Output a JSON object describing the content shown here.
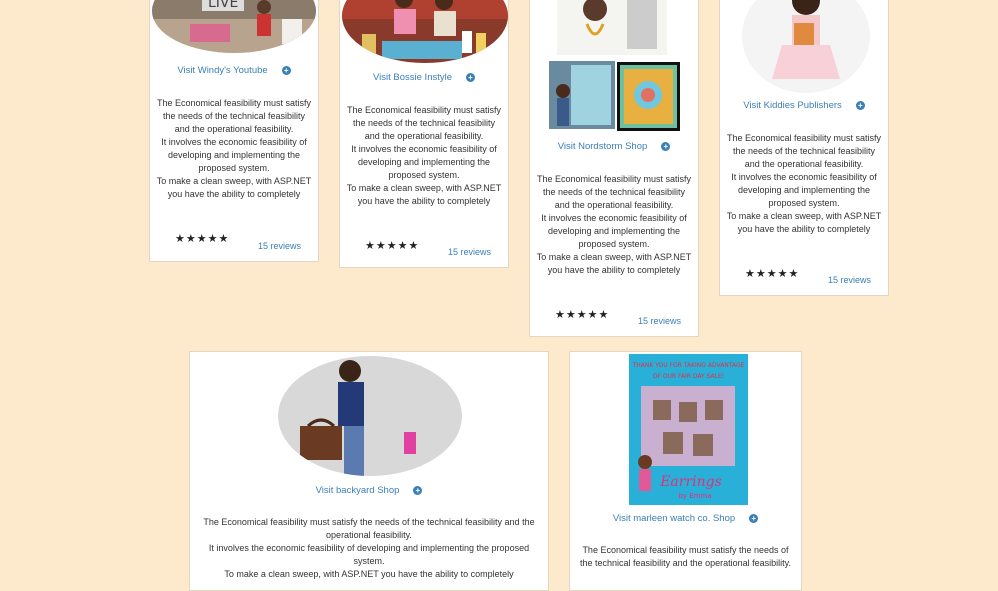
{
  "cards": [
    {
      "link": "Visit Windy's Youtube",
      "desc1": "The Economical feasibility must satisfy the needs of the technical feasibility and the operational feasibility.",
      "desc2": "It involves the economic feasibility of developing and implementing the proposed system.",
      "desc3": "To make a clean sweep, with ASP.NET you have the ability to completely",
      "stars": "★★★★★",
      "reviews": "15 reviews"
    },
    {
      "link": "Visit Bossie Instyle",
      "desc1": "The Economical feasibility must satisfy the needs of the technical feasibility and the operational feasibility.",
      "desc2": "It involves the economic feasibility of developing and implementing the proposed system.",
      "desc3": "To make a clean sweep, with ASP.NET you have the ability to completely",
      "stars": "★★★★★",
      "reviews": "15 reviews"
    },
    {
      "link": "Visit Nordstorm Shop",
      "desc1": "The Economical feasibility must satisfy the needs of the technical feasibility and the operational feasibility.",
      "desc2": "It involves the economic feasibility of developing and implementing the proposed system.",
      "desc3": "To make a clean sweep, with ASP.NET you have the ability to completely",
      "stars": "★★★★★",
      "reviews": "15 reviews"
    },
    {
      "link": "Visit Kiddies Publishers",
      "desc1": "The Economical feasibility must satisfy the needs of the technical feasibility and the operational feasibility.",
      "desc2": "It involves the economic feasibility of developing and implementing the proposed system.",
      "desc3": "To make a clean sweep, with ASP.NET you have the ability to completely",
      "stars": "★★★★★",
      "reviews": "15 reviews"
    },
    {
      "link": "Visit backyard Shop",
      "desc1": "The Economical feasibility must satisfy the needs of the technical feasibility and the operational feasibility.",
      "desc2": "It involves the economic feasibility of developing and implementing the proposed system.",
      "desc3": "To make a clean sweep, with ASP.NET you have the ability to completely"
    },
    {
      "link": "Visit marleen watch co. Shop",
      "desc1": "The Economical feasibility must satisfy the needs of the technical feasibility and the operational feasibility.",
      "poster_line1": "THANK YOU FOR TAKING ADVANTAGE",
      "poster_line2": "OF OUR FAIR DAY SALE!",
      "poster_brand": "Earrings",
      "poster_by": "by Emma"
    }
  ],
  "icons": {
    "plus": "plus-circle-icon",
    "star": "star-icon"
  },
  "colors": {
    "page_bg": "#fde9cc",
    "link": "#3a7fb5"
  }
}
